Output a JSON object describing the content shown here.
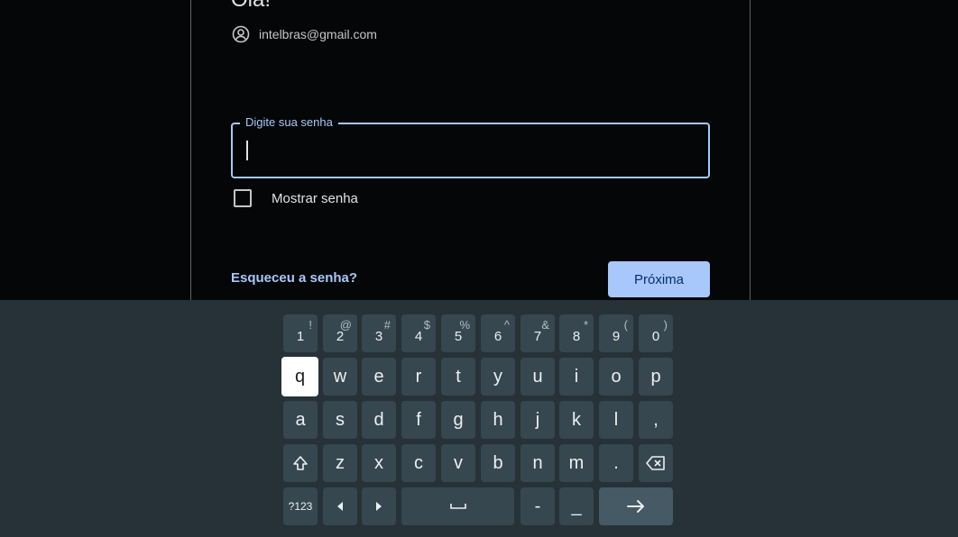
{
  "header": {
    "greeting": "Olá!"
  },
  "account": {
    "email": "intelbras@gmail.com",
    "icon": "account-circle-icon"
  },
  "password_field": {
    "label": "Digite sua senha",
    "value": ""
  },
  "show_password": {
    "label": "Mostrar senha",
    "checked": false
  },
  "links": {
    "forgot_password": "Esqueceu a senha?"
  },
  "buttons": {
    "next": "Próxima"
  },
  "keyboard": {
    "focused_key": "q",
    "number_row": [
      {
        "main": "1",
        "sup": "!"
      },
      {
        "main": "2",
        "sup": "@"
      },
      {
        "main": "3",
        "sup": "#"
      },
      {
        "main": "4",
        "sup": "$"
      },
      {
        "main": "5",
        "sup": "%"
      },
      {
        "main": "6",
        "sup": "^"
      },
      {
        "main": "7",
        "sup": "&"
      },
      {
        "main": "8",
        "sup": "*"
      },
      {
        "main": "9",
        "sup": "("
      },
      {
        "main": "0",
        "sup": ")"
      }
    ],
    "row_q": [
      "q",
      "w",
      "e",
      "r",
      "t",
      "y",
      "u",
      "i",
      "o",
      "p"
    ],
    "row_a": [
      "a",
      "s",
      "d",
      "f",
      "g",
      "h",
      "j",
      "k",
      "l",
      ","
    ],
    "row_z": [
      "z",
      "x",
      "c",
      "v",
      "b",
      "n",
      "m",
      "."
    ],
    "bottom": {
      "symbols": "?123",
      "dash": "-",
      "underscore": "_"
    }
  },
  "colors": {
    "background": "#050607",
    "accent": "#a8c7fa",
    "keyboard_bg": "#263238",
    "key_bg": "#37474f"
  }
}
